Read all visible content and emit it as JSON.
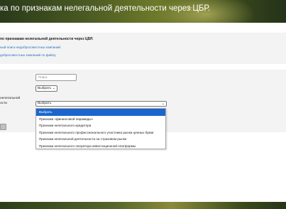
{
  "header": {
    "title": "ка по признакам нелегальной деятельности через ЦБР.",
    "star_icon": "star-icon"
  },
  "info": {
    "heading": "по признакам нелегальной деятельности через ЦБР.",
    "link1": "ный поиск недобросовестных компаний.",
    "link2": "добросовестных компаний по файлу."
  },
  "form": {
    "search_placeholder": "Поиск",
    "select_small_value": "Выбрать",
    "label_line1": "нелегальной",
    "label_line2": "ости",
    "select_big_value": "Выбрать"
  },
  "dropdown": {
    "options": [
      "Выбрать",
      "Признаки «финансовой пирамиды»",
      "Признаки нелегального кредитора",
      "Признаки нелегального профессионального участника рынка ценных бумаг",
      "Признаки нелегальной деятельности на страховом рынке",
      "Признаки нелегального оператора инвестиционной платформы"
    ],
    "selected_index": 0
  },
  "colors": {
    "link": "#2a6ebf",
    "highlight": "#1a66cc",
    "panel": "#f3f3f3"
  }
}
